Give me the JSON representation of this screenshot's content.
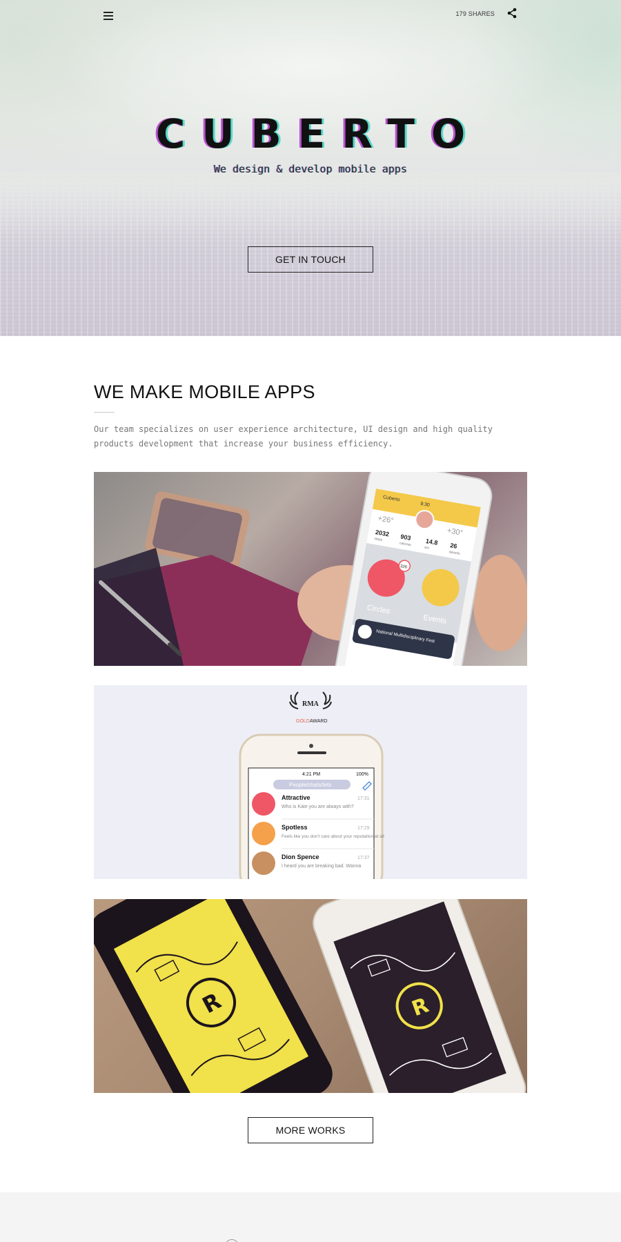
{
  "header": {
    "menu_icon": "hamburger-icon",
    "shares_text": "179 SHARES",
    "share_icon": "share-icon"
  },
  "hero": {
    "brand": "CUBERTO",
    "tagline": "We design & develop mobile apps",
    "cta_label": "GET IN TOUCH"
  },
  "about": {
    "title": "WE MAKE MOBILE APPS",
    "description": "Our team specializes on user experience architecture, UI design and high quality products development that increase your business efficiency."
  },
  "works": [
    {
      "kind": "fitness-app-photo",
      "app_header": "Cuberto",
      "time": "9:30",
      "temp_left": "+26°",
      "temp_right": "+30°",
      "stats": [
        {
          "value": "2032",
          "label": "steps"
        },
        {
          "value": "903",
          "label": "calories"
        },
        {
          "value": "14.8",
          "label": "km"
        },
        {
          "value": "26",
          "label": "awards"
        }
      ],
      "badge": "326",
      "bubble_left": "Circles",
      "bubble_right": "Events",
      "event_title": "National Multidisciplinary Fest"
    },
    {
      "kind": "chat-app-mockup",
      "award_label_1": "GOLD",
      "award_label_2": "AWARD",
      "award_monogram": "RMA",
      "status_time": "4:21 PM",
      "battery": "100%",
      "search_placeholder": "People/chats/tets",
      "chats": [
        {
          "name": "Attractive",
          "time": "17:31",
          "message": "Who is Kate you are always with?",
          "avatar_color": "#ef5766"
        },
        {
          "name": "Spotless",
          "time": "17:29",
          "message": "Feels like you don't care about your reputation at all",
          "avatar_color": "#f5a04a"
        },
        {
          "name": "Dion Spence",
          "time": "17:37",
          "message": "I heard you are breaking bad. Wanna",
          "avatar_color": "#c89060"
        }
      ]
    },
    {
      "kind": "illustrated-phones-photo",
      "logo_letter": "R",
      "accent_yellow": "#f1e14a",
      "accent_dark": "#2a1f2a"
    }
  ],
  "more_label": "MORE WORKS"
}
